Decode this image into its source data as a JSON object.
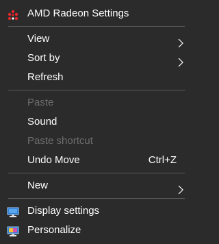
{
  "menu": {
    "amd": {
      "label": "AMD Radeon Settings",
      "icon": "amd-radeon-icon"
    },
    "view": {
      "label": "View",
      "has_submenu": true
    },
    "sort_by": {
      "label": "Sort by",
      "has_submenu": true
    },
    "refresh": {
      "label": "Refresh"
    },
    "paste": {
      "label": "Paste",
      "enabled": false
    },
    "sound": {
      "label": "Sound"
    },
    "paste_shortcut": {
      "label": "Paste shortcut",
      "enabled": false
    },
    "undo_move": {
      "label": "Undo Move",
      "shortcut": "Ctrl+Z"
    },
    "new": {
      "label": "New",
      "has_submenu": true
    },
    "display_settings": {
      "label": "Display settings",
      "icon": "display-settings-icon"
    },
    "personalize": {
      "label": "Personalize",
      "icon": "personalize-icon"
    }
  },
  "colors": {
    "background": "#2b2b2b",
    "text": "#ffffff",
    "disabled_text": "#6d6d6d",
    "separator": "#5a5a5a",
    "amd_red": "#e2262c",
    "monitor_blue": "#2f7fd6"
  }
}
